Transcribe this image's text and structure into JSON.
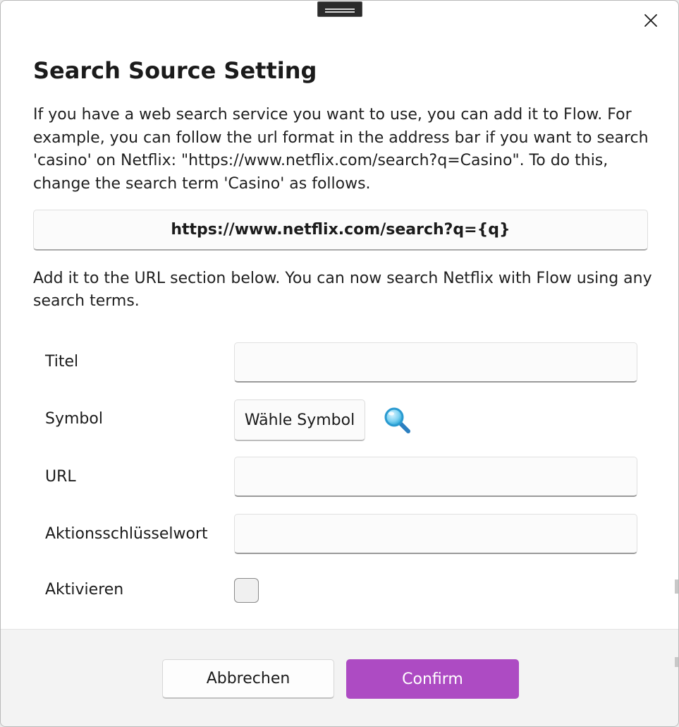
{
  "dialog": {
    "title": "Search Source Setting",
    "description": "If you have a web search service you want to use, you can add it to Flow. For example, you can follow the url format in the address bar if you want to search 'casino' on Netflix: \"https://www.netflix.com/search?q=Casino\". To do this, change the search term 'Casino' as follows.",
    "example_url": "https://www.netflix.com/search?q={q}",
    "description2": "Add it to the URL section below. You can now search Netflix with Flow using any search terms."
  },
  "form": {
    "title_label": "Titel",
    "title_value": "",
    "symbol_label": "Symbol",
    "symbol_button": "Wähle Symbol",
    "url_label": "URL",
    "url_value": "",
    "keyword_label": "Aktionsschlüsselwort",
    "keyword_value": "",
    "enable_label": "Aktivieren",
    "enabled": false
  },
  "footer": {
    "cancel_label": "Abbrechen",
    "confirm_label": "Confirm"
  },
  "icons": {
    "close": "close-icon",
    "symbol_preview": "magnifier-icon",
    "drag": "drag-handle-icon"
  },
  "colors": {
    "accent": "#ad4bc3",
    "footer_bg": "#f3f3f3",
    "magnifier": "#2aa7d8"
  }
}
